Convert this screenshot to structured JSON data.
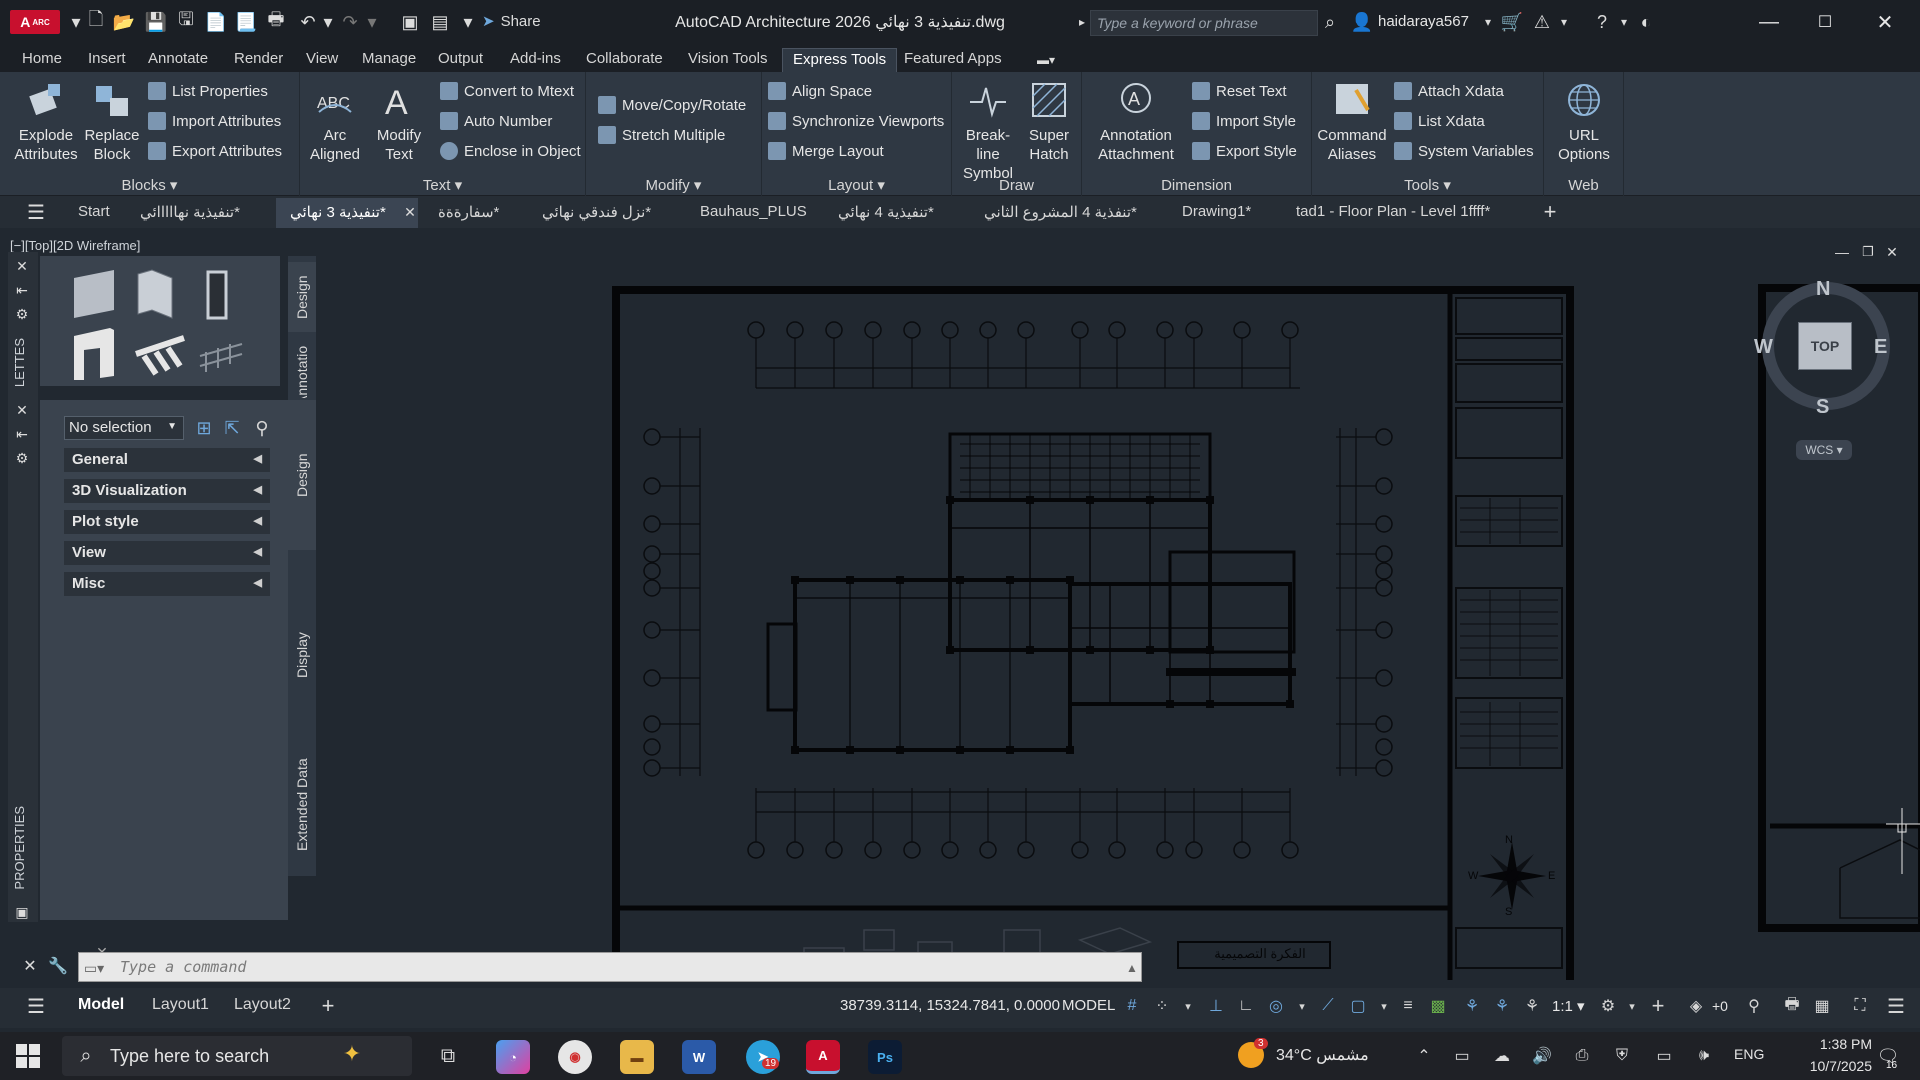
{
  "app": {
    "logo_text": "A",
    "logo_badge": "ARC",
    "title": "AutoCAD Architecture 2026    تنفيذية 3 نهائي.dwg",
    "share_label": "Share",
    "search_placeholder": "Type a keyword or phrase",
    "user": "haidaraya567"
  },
  "ribbon_tabs": [
    "Home",
    "Insert",
    "Annotate",
    "Render",
    "View",
    "Manage",
    "Output",
    "Add-ins",
    "Collaborate",
    "Vision Tools",
    "Express Tools",
    "Featured Apps"
  ],
  "active_ribbon_tab": "Express Tools",
  "ribbon": {
    "blocks": {
      "title": "Blocks",
      "explode_attributes": "Explode Attributes",
      "replace_block": "Replace Block",
      "list_properties": "List Properties",
      "import_attributes": "Import Attributes",
      "export_attributes": "Export Attributes"
    },
    "text": {
      "title": "Text",
      "arc_aligned": "Arc Aligned",
      "modify_text": "Modify Text",
      "convert_to_mtext": "Convert to Mtext",
      "auto_number": "Auto Number",
      "enclose_in_object": "Enclose in Object"
    },
    "modify": {
      "title": "Modify",
      "move_copy_rotate": "Move/Copy/Rotate",
      "stretch_multiple": "Stretch Multiple"
    },
    "layout": {
      "title": "Layout",
      "align_space": "Align Space",
      "synchronize_viewports": "Synchronize Viewports",
      "merge_layout": "Merge Layout"
    },
    "draw": {
      "title": "Draw",
      "break_line_symbol": "Break-line Symbol",
      "super_hatch": "Super Hatch"
    },
    "dimension": {
      "title": "Dimension",
      "annotation_attachment": "Annotation Attachment",
      "reset_text": "Reset Text",
      "import_style": "Import Style",
      "export_style": "Export Style"
    },
    "tools": {
      "title": "Tools",
      "command_aliases": "Command Aliases",
      "attach_xdata": "Attach Xdata",
      "list_xdata": "List Xdata",
      "system_variables": "System Variables"
    },
    "web": {
      "title": "Web",
      "url_options": "URL Options"
    }
  },
  "file_tabs": [
    "Start",
    "تنفيذية نهااااائي*",
    "تنفيذية 3 نهائي*",
    "سفارةةة*",
    "نزل فندقي نهائي*",
    "Bauhaus_PLUS",
    "تنفيذية 4 نهائي*",
    "تنفذية 4 المشروع الثاني*",
    "Drawing1*",
    "tad1 - Floor Plan - Level 1ffff*"
  ],
  "active_file_tab": "تنفيذية 3 نهائي*",
  "viewport_label": "[−][Top][2D Wireframe]",
  "palette": {
    "side_title": "PROPERTIES",
    "side_title2": "LETTES",
    "tabs": [
      "Design",
      "Annotation",
      "Design",
      "Display",
      "Extended Data"
    ],
    "selection": "No selection",
    "categories": [
      "General",
      "3D Visualization",
      "Plot style",
      "View",
      "Misc"
    ]
  },
  "viewcube": {
    "n": "N",
    "s": "S",
    "e": "E",
    "w": "W",
    "face": "TOP",
    "wcs": "WCS"
  },
  "drawing": {
    "title_block_text": "الفكرة التصميمية",
    "north_n": "N",
    "north_s": "S",
    "north_e": "E",
    "north_w": "W"
  },
  "command_line": {
    "placeholder": "Type a command"
  },
  "layout_tabs": [
    "Model",
    "Layout1",
    "Layout2"
  ],
  "active_layout": "Model",
  "status": {
    "coords": "38739.3114, 15324.7841, 0.0000",
    "space": "MODEL",
    "scale": "1:1",
    "plus_zero": "+0"
  },
  "taskbar": {
    "search": "Type here to search",
    "weather": "34°C  مشمس",
    "weather_badge": "3",
    "lang": "ENG",
    "time": "1:38 PM",
    "date": "10/7/2025",
    "notif_count": "16",
    "telegram_badge": "19"
  }
}
